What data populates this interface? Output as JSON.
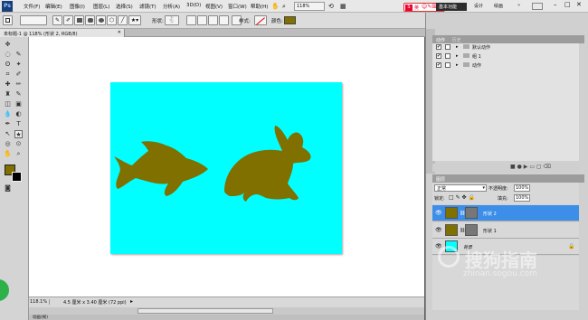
{
  "app": {
    "logo_text": "Ps",
    "menu": [
      "文件(F)",
      "编辑(E)",
      "图像(I)",
      "图层(L)",
      "选择(S)",
      "滤镜(T)",
      "分析(A)",
      "3D(D)",
      "视图(V)",
      "窗口(W)",
      "帮助(H)"
    ],
    "zoom": "118%",
    "workspace_label": "基本功能",
    "workspace_items": [
      "设计",
      "绘画"
    ],
    "brand_badge": "英"
  },
  "options_bar": {
    "shape_label": "形状:",
    "style_label": "样式:",
    "color_label": "颜色:",
    "shape_color": "#7f7000"
  },
  "document": {
    "tab_title": "未标题-1 @ 118% (形状 2, RGB/8)",
    "canvas_color": "#00ffff",
    "shape_color": "#7f7000"
  },
  "status": {
    "zoom": "118.1%",
    "doc_info": "4.5 厘米 x 3.40 厘米 (72 ppi)",
    "bottom_tab": "动画(帧)"
  },
  "actions_panel": {
    "tabs": [
      "动作",
      "历史"
    ],
    "items": [
      {
        "label": "默认动作",
        "checked": true
      },
      {
        "label": "组 1",
        "checked": true
      },
      {
        "label": "动作",
        "checked": true
      }
    ]
  },
  "layers_panel": {
    "tab": "图层",
    "blend_mode": "正常",
    "opacity_label": "不透明度:",
    "opacity_value": "100%",
    "lock_label": "锁定:",
    "fill_label": "填充:",
    "fill_value": "100%",
    "layers": [
      {
        "name": "形状 2",
        "selected": true
      },
      {
        "name": "形状 1",
        "selected": false
      },
      {
        "name": "背景",
        "selected": false
      }
    ]
  },
  "watermark": {
    "text": "搜狗指南",
    "url": "zhinan.sogou.com"
  }
}
